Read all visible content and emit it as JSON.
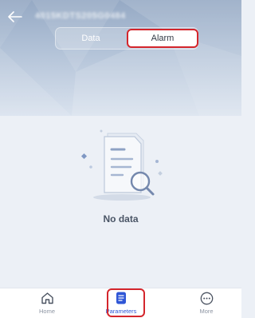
{
  "header": {
    "device_id": "4015KDTS205G0484"
  },
  "tabs": [
    {
      "label": "Data",
      "selected": false
    },
    {
      "label": "Alarm",
      "selected": true
    }
  ],
  "empty_state": {
    "message": "No data",
    "icon": "document-search-icon"
  },
  "bottom_nav": {
    "items": [
      {
        "label": "Home",
        "icon": "home-icon",
        "active": false
      },
      {
        "label": "Parameters",
        "icon": "parameters-icon",
        "active": true
      },
      {
        "label": "More",
        "icon": "more-icon",
        "active": false
      }
    ]
  },
  "colors": {
    "accent": "#2f56d6",
    "highlight": "#d4262c",
    "header_gradient_top": "#95a9c4",
    "page_background": "#ecf0f6"
  }
}
